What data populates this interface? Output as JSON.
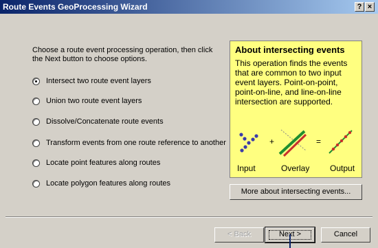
{
  "window": {
    "title": "Route Events GeoProcessing Wizard",
    "help_label": "?",
    "close_label": "×"
  },
  "instructions": "Choose a route event processing operation, then click the Next button to choose options.",
  "options": [
    {
      "label": "Intersect two route event layers",
      "selected": true
    },
    {
      "label": "Union two route event layers",
      "selected": false
    },
    {
      "label": "Dissolve/Concatenate route events",
      "selected": false
    },
    {
      "label": "Transform events from one route reference to another",
      "selected": false
    },
    {
      "label": "Locate point features along routes",
      "selected": false
    },
    {
      "label": "Locate polygon features along routes",
      "selected": false
    }
  ],
  "info": {
    "title": "About intersecting events",
    "body": "This operation finds the events that are common to two input event layers. Point-on-point, point-on-line, and line-on-line intersection are supported.",
    "plus": "+",
    "equals": "=",
    "labels": {
      "input": "Input",
      "overlay": "Overlay",
      "output": "Output"
    },
    "background_color": "#ffff80"
  },
  "more_button_label": "More about intersecting events...",
  "buttons": {
    "back": "< Back",
    "next": "Next >",
    "cancel": "Cancel"
  }
}
